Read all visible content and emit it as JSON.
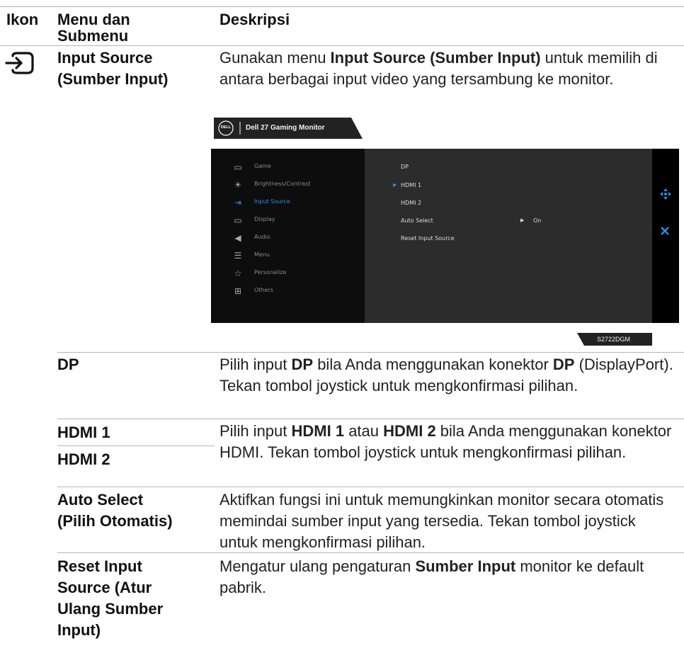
{
  "headers": {
    "icon": "Ikon",
    "menu": "Menu dan\nSubmenu",
    "desc": "Deskripsi"
  },
  "main": {
    "icon": "input-source-icon",
    "name": "Input Source\n(Sumber Input)",
    "desc_pre": "Gunakan menu ",
    "desc_bold": "Input Source (Sumber Input)",
    "desc_post": " untuk memilih di antara berbagai input video yang tersambung ke monitor."
  },
  "osd": {
    "logo": "DELL",
    "title": "Dell 27 Gaming Monitor",
    "menu_items": [
      {
        "label": "Game",
        "icon": "game-icon"
      },
      {
        "label": "Brightness/Contrast",
        "icon": "brightness-icon"
      },
      {
        "label": "Input Source",
        "icon": "input-source-icon",
        "active": true
      },
      {
        "label": "Display",
        "icon": "display-icon"
      },
      {
        "label": "Audio",
        "icon": "audio-icon"
      },
      {
        "label": "Menu",
        "icon": "menu-icon"
      },
      {
        "label": "Personalize",
        "icon": "star-icon"
      },
      {
        "label": "Others",
        "icon": "others-icon"
      }
    ],
    "sub_items": [
      {
        "label": "DP"
      },
      {
        "label": "HDMI 1",
        "selected": true
      },
      {
        "label": "HDMI 2"
      },
      {
        "label": "Auto Select",
        "value": "On"
      },
      {
        "label": "Reset Input Source"
      }
    ],
    "model": "S2722DGM",
    "accent": "#2d8de6"
  },
  "rows": {
    "dp": {
      "name": "DP",
      "p1": "Pilih input ",
      "b1": "DP",
      "p2": " bila Anda menggunakan konektor ",
      "b2": "DP",
      "p3": " (DisplayPort). Tekan tombol joystick untuk mengkonfirmasi pilihan."
    },
    "hdmi": {
      "name1": "HDMI 1",
      "name2": "HDMI 2",
      "p1": "Pilih input ",
      "b1": "HDMI 1",
      "p2": " atau ",
      "b2": "HDMI 2",
      "p3": " bila Anda menggunakan konektor HDMI. Tekan tombol joystick untuk mengkonfirmasi pilihan."
    },
    "auto": {
      "name": "Auto Select\n(Pilih Otomatis)",
      "desc": "Aktifkan fungsi ini untuk memungkinkan monitor secara otomatis memindai sumber input yang tersedia. Tekan tombol joystick untuk mengkonfirmasi pilihan."
    },
    "reset": {
      "name": "Reset Input\nSource (Atur\nUlang Sumber\nInput)",
      "p1": "Mengatur ulang pengaturan ",
      "b1": "Sumber Input",
      "p2": " monitor ke default pabrik."
    }
  }
}
